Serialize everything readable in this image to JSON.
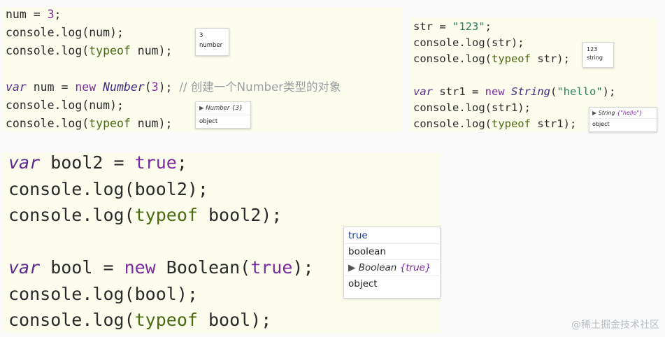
{
  "panel_number": {
    "lines": [
      [
        {
          "t": "num = ",
          "c": ""
        },
        {
          "t": "3",
          "c": "num"
        },
        {
          "t": ";",
          "c": ""
        }
      ],
      [
        {
          "t": "console.log(num);",
          "c": ""
        }
      ],
      [
        {
          "t": "console.log(",
          "c": ""
        },
        {
          "t": "typeof",
          "c": "tof"
        },
        {
          "t": " num);",
          "c": ""
        }
      ],
      [],
      [
        {
          "t": "var",
          "c": "kw-i"
        },
        {
          "t": " num = ",
          "c": ""
        },
        {
          "t": "new",
          "c": "kw"
        },
        {
          "t": " ",
          "c": ""
        },
        {
          "t": "Number",
          "c": "cls"
        },
        {
          "t": "(",
          "c": ""
        },
        {
          "t": "3",
          "c": "num"
        },
        {
          "t": "); ",
          "c": ""
        },
        {
          "t": "// 创建一个Number类型的对象",
          "c": "cmt"
        }
      ],
      [
        {
          "t": "console.log(num);",
          "c": ""
        }
      ],
      [
        {
          "t": "console.log(",
          "c": ""
        },
        {
          "t": "typeof",
          "c": "tof"
        },
        {
          "t": " num);",
          "c": ""
        }
      ]
    ],
    "popup1": [
      "3",
      "number"
    ],
    "popup2": {
      "tri": "▶",
      "obj": "Number",
      "val": "{3}",
      "type": "object"
    }
  },
  "panel_string": {
    "lines": [
      [
        {
          "t": "str = ",
          "c": ""
        },
        {
          "t": "\"123\"",
          "c": "str"
        },
        {
          "t": ";",
          "c": ""
        }
      ],
      [
        {
          "t": "console.log(str);",
          "c": ""
        }
      ],
      [
        {
          "t": "console.log(",
          "c": ""
        },
        {
          "t": "typeof",
          "c": "tof"
        },
        {
          "t": " str);",
          "c": ""
        }
      ],
      [],
      [
        {
          "t": "var",
          "c": "kw-i"
        },
        {
          "t": " str1 = ",
          "c": ""
        },
        {
          "t": "new",
          "c": "kw"
        },
        {
          "t": " ",
          "c": ""
        },
        {
          "t": "String",
          "c": "cls"
        },
        {
          "t": "(",
          "c": ""
        },
        {
          "t": "\"hello\"",
          "c": "str"
        },
        {
          "t": ");",
          "c": ""
        }
      ],
      [
        {
          "t": "console.log(str1);",
          "c": ""
        }
      ],
      [
        {
          "t": "console.log(",
          "c": ""
        },
        {
          "t": "typeof",
          "c": "tof"
        },
        {
          "t": " str1);",
          "c": ""
        }
      ]
    ],
    "popup1": [
      "123",
      "string"
    ],
    "popup2": {
      "tri": "▶",
      "obj": "String",
      "val": "{\"hello\"}",
      "type": "object"
    }
  },
  "panel_boolean": {
    "lines": [
      [
        {
          "t": "var",
          "c": "kw-i"
        },
        {
          "t": " bool2 = ",
          "c": ""
        },
        {
          "t": "true",
          "c": "kw"
        },
        {
          "t": ";",
          "c": ""
        }
      ],
      [
        {
          "t": "console.log(bool2);",
          "c": ""
        }
      ],
      [
        {
          "t": "console.log(",
          "c": ""
        },
        {
          "t": "typeof",
          "c": "tof"
        },
        {
          "t": " bool2);",
          "c": ""
        }
      ],
      [],
      [
        {
          "t": "var",
          "c": "kw-i"
        },
        {
          "t": " bool = ",
          "c": ""
        },
        {
          "t": "new",
          "c": "kw"
        },
        {
          "t": " Boolean(",
          "c": ""
        },
        {
          "t": "true",
          "c": "kw"
        },
        {
          "t": ");",
          "c": ""
        }
      ],
      [
        {
          "t": "console.log(bool);",
          "c": ""
        }
      ],
      [
        {
          "t": "console.log(",
          "c": ""
        },
        {
          "t": "typeof",
          "c": "tof"
        },
        {
          "t": " bool);",
          "c": ""
        }
      ]
    ],
    "popup": {
      "val1": "true",
      "type1": "boolean",
      "tri": "▶",
      "obj": "Boolean",
      "val2": "{true}",
      "type2": "object"
    }
  },
  "watermark": "@稀土掘金技术社区"
}
